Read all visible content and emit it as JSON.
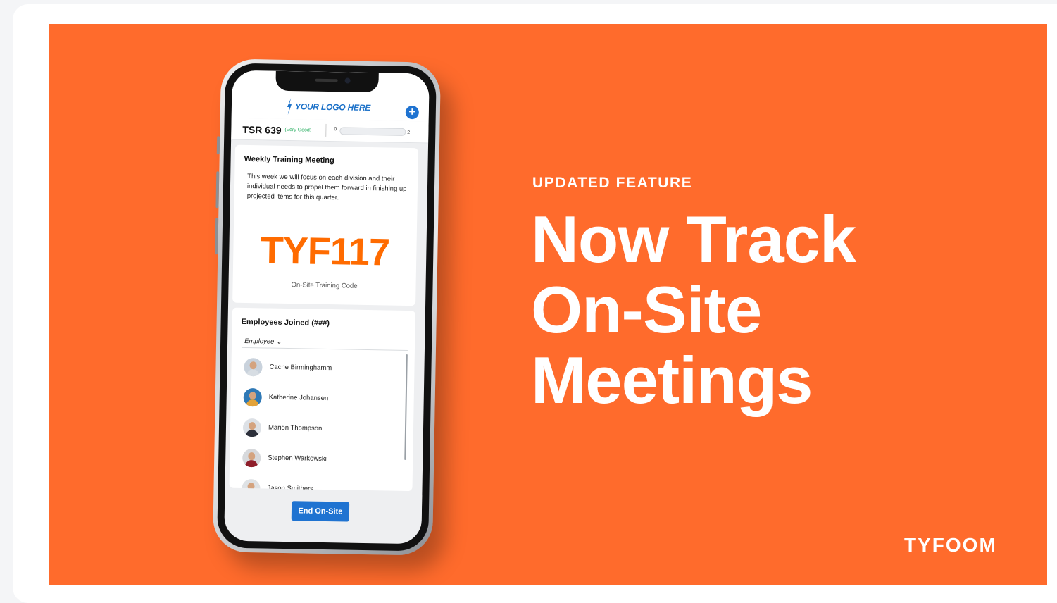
{
  "colors": {
    "banner": "#ff6b2c",
    "accent_blue": "#1f73d1",
    "code_orange": "#ff6b00",
    "grade_green": "#27ae60"
  },
  "phone": {
    "logo_icon": "lightning-bolt-icon",
    "logo_text": "YOUR LOGO HERE",
    "add_icon": "plus-icon",
    "add_symbol": "+",
    "tsr_label": "TSR 639",
    "tsr_grade": "(Very Good)",
    "tsr_min": "0",
    "tsr_max": "2",
    "meeting_title": "Weekly Training Meeting",
    "meeting_desc": "This week we will focus on each division and their individual needs to propel them forward in finishing up projected items for this quarter.",
    "training_code": "TYF117",
    "training_code_caption": "On-Site Training Code",
    "employees_title": "Employees Joined (###)",
    "sort_label": "Employee ⌄",
    "employees": [
      {
        "name": "Cache Birminghamm",
        "avatar_color": "#c9d2dc",
        "shirt": "#d7dde3"
      },
      {
        "name": "Katherine Johansen",
        "avatar_color": "#2f79b6",
        "shirt": "#e3a33a"
      },
      {
        "name": "Marion Thompson",
        "avatar_color": "#dde1e6",
        "shirt": "#2c2f3a"
      },
      {
        "name": "Stephen Warkowski",
        "avatar_color": "#d7d9dc",
        "shirt": "#8f1e2a"
      },
      {
        "name": "Jason Smithers",
        "avatar_color": "#dfe2e5",
        "shirt": "#8893a0"
      }
    ],
    "end_button": "End On-Site"
  },
  "feature_tag": "UPDATED FEATURE",
  "headline": "Now Track\nOn-Site\nMeetings",
  "brand": "TYFOOM"
}
